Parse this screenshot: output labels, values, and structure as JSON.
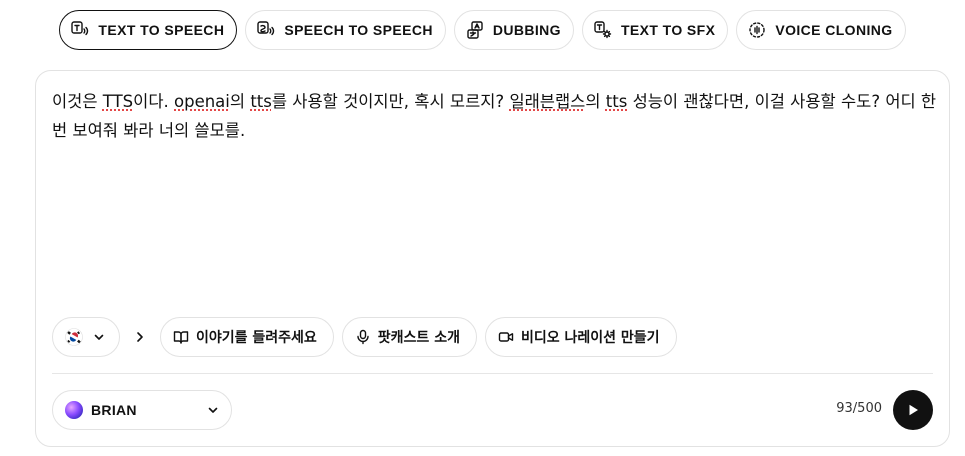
{
  "tabs": [
    {
      "label": "TEXT TO SPEECH",
      "icon": "text-to-speech-icon",
      "active": true
    },
    {
      "label": "SPEECH TO SPEECH",
      "icon": "speech-to-speech-icon",
      "active": false
    },
    {
      "label": "DUBBING",
      "icon": "dubbing-icon",
      "active": false
    },
    {
      "label": "TEXT TO SFX",
      "icon": "text-to-sfx-icon",
      "active": false
    },
    {
      "label": "VOICE CLONING",
      "icon": "voice-cloning-icon",
      "active": false
    }
  ],
  "editor": {
    "segments": [
      {
        "text": "이것은 ",
        "spell": false
      },
      {
        "text": "TTS",
        "spell": true
      },
      {
        "text": "이다. ",
        "spell": false
      },
      {
        "text": "openai",
        "spell": true
      },
      {
        "text": "의 ",
        "spell": false
      },
      {
        "text": "tts",
        "spell": true
      },
      {
        "text": "를 사용할 것이지만, 혹시 모르지? ",
        "spell": false
      },
      {
        "text": "일래븐랩스",
        "spell": true
      },
      {
        "text": "의 ",
        "spell": false
      },
      {
        "text": "tts",
        "spell": true
      },
      {
        "text": " 성능이 괜찮다면, 이걸 사용할 수도? 어디 한번 보여줘 봐라 너의 쓸모를.",
        "spell": false
      }
    ]
  },
  "language": {
    "flag": "south-korea-flag-icon",
    "chevron": "chevron-down-icon"
  },
  "suggestions": [
    {
      "label": "이야기를 들려주세요",
      "icon": "book-icon"
    },
    {
      "label": "팟캐스트 소개",
      "icon": "microphone-icon"
    },
    {
      "label": "비디오 나레이션 만들기",
      "icon": "video-icon"
    }
  ],
  "voice": {
    "name": "BRIAN"
  },
  "char_count": "93/500",
  "colors": {
    "accent": "#111111",
    "border": "#e2e2e2",
    "spellcheck": "#dd2222"
  }
}
